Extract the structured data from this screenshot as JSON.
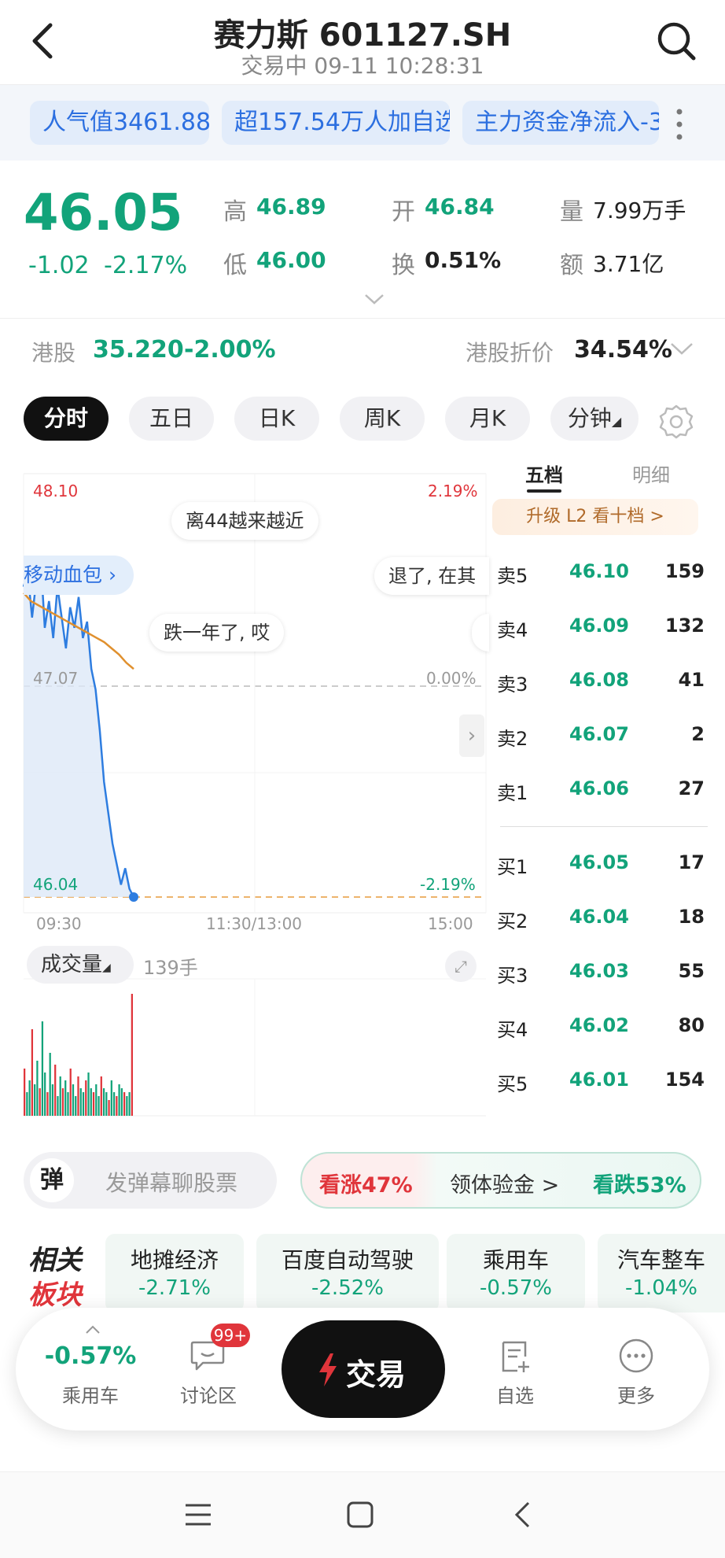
{
  "header": {
    "title": "赛力斯 601127.SH",
    "subtitle": "交易中 09-11 10:28:31"
  },
  "tags": [
    {
      "label": "人气值3461.88"
    },
    {
      "label": "超157.54万人加自选"
    },
    {
      "label": "主力资金净流入-3"
    }
  ],
  "quote": {
    "price": "46.05",
    "change": "-1.02",
    "change_pct": "-2.17%",
    "high_label": "高",
    "high": "46.89",
    "low_label": "低",
    "low": "46.00",
    "open_label": "开",
    "open": "46.84",
    "turnover_label": "换",
    "turnover": "0.51%",
    "volume_label": "量",
    "volume": "7.99万手",
    "amount_label": "额",
    "amount": "3.71亿"
  },
  "hk": {
    "label": "港股",
    "price": "35.220",
    "pct": "-2.00%",
    "discount_label": "港股折价",
    "discount": "34.54%"
  },
  "period_tabs": [
    "分时",
    "五日",
    "日K",
    "周K",
    "月K",
    "分钟"
  ],
  "chart": {
    "y_top": "48.10",
    "y_mid": "47.07",
    "y_low": "46.04",
    "pct_top": "2.19%",
    "pct_mid": "0.00%",
    "pct_low": "-2.19%",
    "x_start": "09:30",
    "x_mid": "11:30/13:00",
    "x_end": "15:00",
    "bullets": [
      "离44越来越近",
      "移动血包",
      "退了, 在其",
      "跌一年了, 哎"
    ],
    "volume_label": "成交量",
    "volume_value": "139手"
  },
  "chart_data": {
    "type": "line",
    "series": [
      {
        "values": [
          47.55,
          47.62,
          47.4,
          47.58,
          47.7,
          47.35,
          47.48,
          47.3,
          47.55,
          47.4,
          47.25,
          47.45,
          47.35,
          47.5,
          47.3,
          47.38,
          47.15,
          47.05,
          46.85,
          46.6,
          46.45,
          46.3,
          46.2,
          46.1,
          46.18,
          46.08,
          46.04
        ]
      },
      {
        "values": [
          47.52,
          47.48,
          47.46,
          47.44,
          47.42,
          47.4,
          47.38,
          47.36,
          47.34,
          47.32,
          47.3,
          47.28,
          47.25,
          47.22,
          47.18,
          47.15
        ]
      }
    ],
    "ylim": [
      46.04,
      48.1
    ],
    "x_ticks": [
      "09:30",
      "11:30/13:00",
      "15:00"
    ]
  },
  "orderbook": {
    "tabs": [
      "五档",
      "明细"
    ],
    "upgrade": "升级 L2 看十档 >",
    "asks": [
      {
        "label": "卖5",
        "price": "46.10",
        "vol": "159"
      },
      {
        "label": "卖4",
        "price": "46.09",
        "vol": "132"
      },
      {
        "label": "卖3",
        "price": "46.08",
        "vol": "41"
      },
      {
        "label": "卖2",
        "price": "46.07",
        "vol": "2"
      },
      {
        "label": "卖1",
        "price": "46.06",
        "vol": "27"
      }
    ],
    "bids": [
      {
        "label": "买1",
        "price": "46.05",
        "vol": "17"
      },
      {
        "label": "买2",
        "price": "46.04",
        "vol": "18"
      },
      {
        "label": "买3",
        "price": "46.03",
        "vol": "55"
      },
      {
        "label": "买4",
        "price": "46.02",
        "vol": "80"
      },
      {
        "label": "买5",
        "price": "46.01",
        "vol": "154"
      }
    ]
  },
  "danmaku": {
    "badge": "弹",
    "placeholder": "发弹幕聊股票",
    "bull": "看涨47%",
    "middle": "领体验金 >",
    "bear": "看跌53%"
  },
  "related": {
    "title_line1": "相关",
    "title_line2": "板块",
    "sectors": [
      {
        "name": "地摊经济",
        "pct": "-2.71%"
      },
      {
        "name": "百度自动驾驶",
        "pct": "-2.52%"
      },
      {
        "name": "乘用车",
        "pct": "-0.57%"
      },
      {
        "name": "汽车整车",
        "pct": "-1.04%"
      }
    ]
  },
  "bottom": {
    "sector_pct": "-0.57%",
    "sector_name": "乘用车",
    "discuss_badge": "99+",
    "discuss_label": "讨论区",
    "trade_label": "交易",
    "watch_label": "自选",
    "more_label": "更多"
  },
  "colors": {
    "green": "#12a37a",
    "red": "#e0353b",
    "accent_blue": "#2c6fe0"
  }
}
